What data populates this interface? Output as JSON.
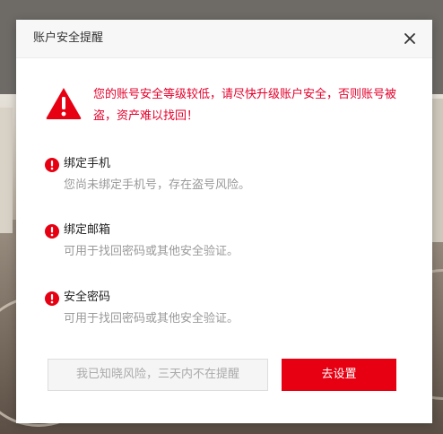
{
  "dialog": {
    "title": "账户安全提醒",
    "close_icon": "close-icon",
    "warning": {
      "icon": "warning-triangle-icon",
      "text": "您的账号安全等级较低，请尽快升级账户安全，否则账号被盗，资产难以找回！"
    },
    "items": [
      {
        "icon": "alert-circle-icon",
        "title": "绑定手机",
        "desc": "您尚未绑定手机号，存在盗号风险。"
      },
      {
        "icon": "alert-circle-icon",
        "title": "绑定邮箱",
        "desc": "可用于找回密码或其他安全验证。"
      },
      {
        "icon": "alert-circle-icon",
        "title": "安全密码",
        "desc": "可用于找回密码或其他安全验证。"
      }
    ],
    "buttons": {
      "dismiss_label": "我已知晓风险，三天内不在提醒",
      "setup_label": "去设置"
    }
  },
  "colors": {
    "accent_red": "#e60012",
    "warning_text_red": "#e4002b",
    "muted_text": "#999999"
  }
}
